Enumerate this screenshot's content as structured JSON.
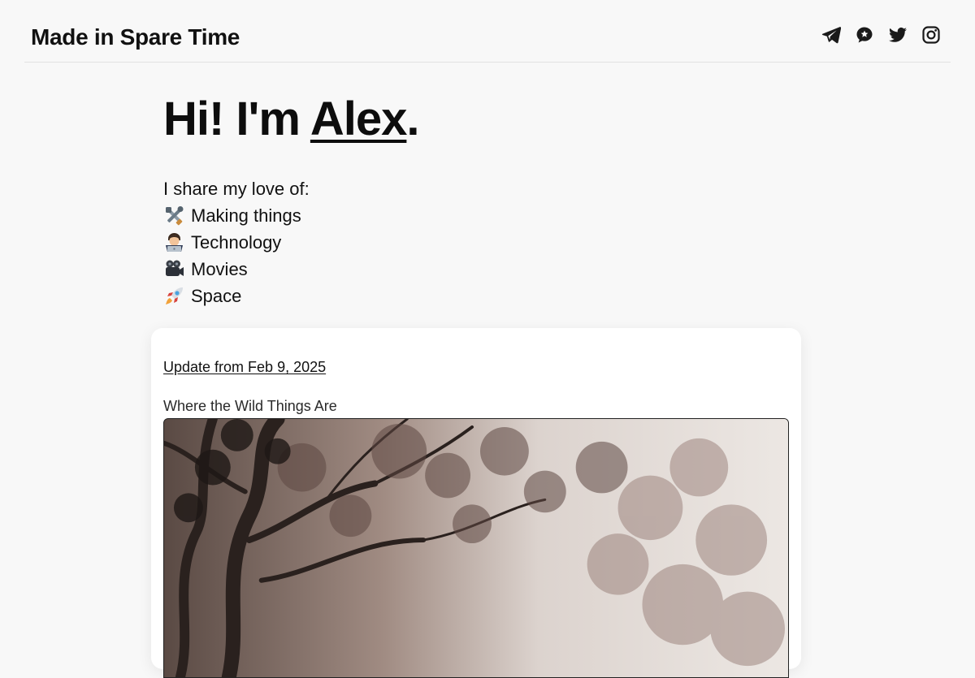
{
  "header": {
    "site_title": "Made in Spare Time",
    "social": [
      {
        "name": "telegram-icon"
      },
      {
        "name": "mastodon-icon"
      },
      {
        "name": "twitter-icon"
      },
      {
        "name": "instagram-icon"
      }
    ]
  },
  "hero": {
    "greeting_prefix": "Hi! I'm ",
    "name": "Alex",
    "greeting_suffix": "."
  },
  "intro": {
    "lead": "I share my love of:",
    "interests": [
      {
        "emoji": "tools-emoji",
        "label": "Making things"
      },
      {
        "emoji": "technologist-emoji",
        "label": "Technology"
      },
      {
        "emoji": "movie-camera-emoji",
        "label": "Movies"
      },
      {
        "emoji": "rocket-emoji",
        "label": "Space"
      }
    ]
  },
  "post": {
    "update_link": "Update from Feb 9, 2025",
    "caption": "Where the Wild Things Are",
    "image": "misty-tree-photo"
  },
  "colors": {
    "background": "#f8f8f8",
    "text": "#111111",
    "card": "#ffffff"
  }
}
